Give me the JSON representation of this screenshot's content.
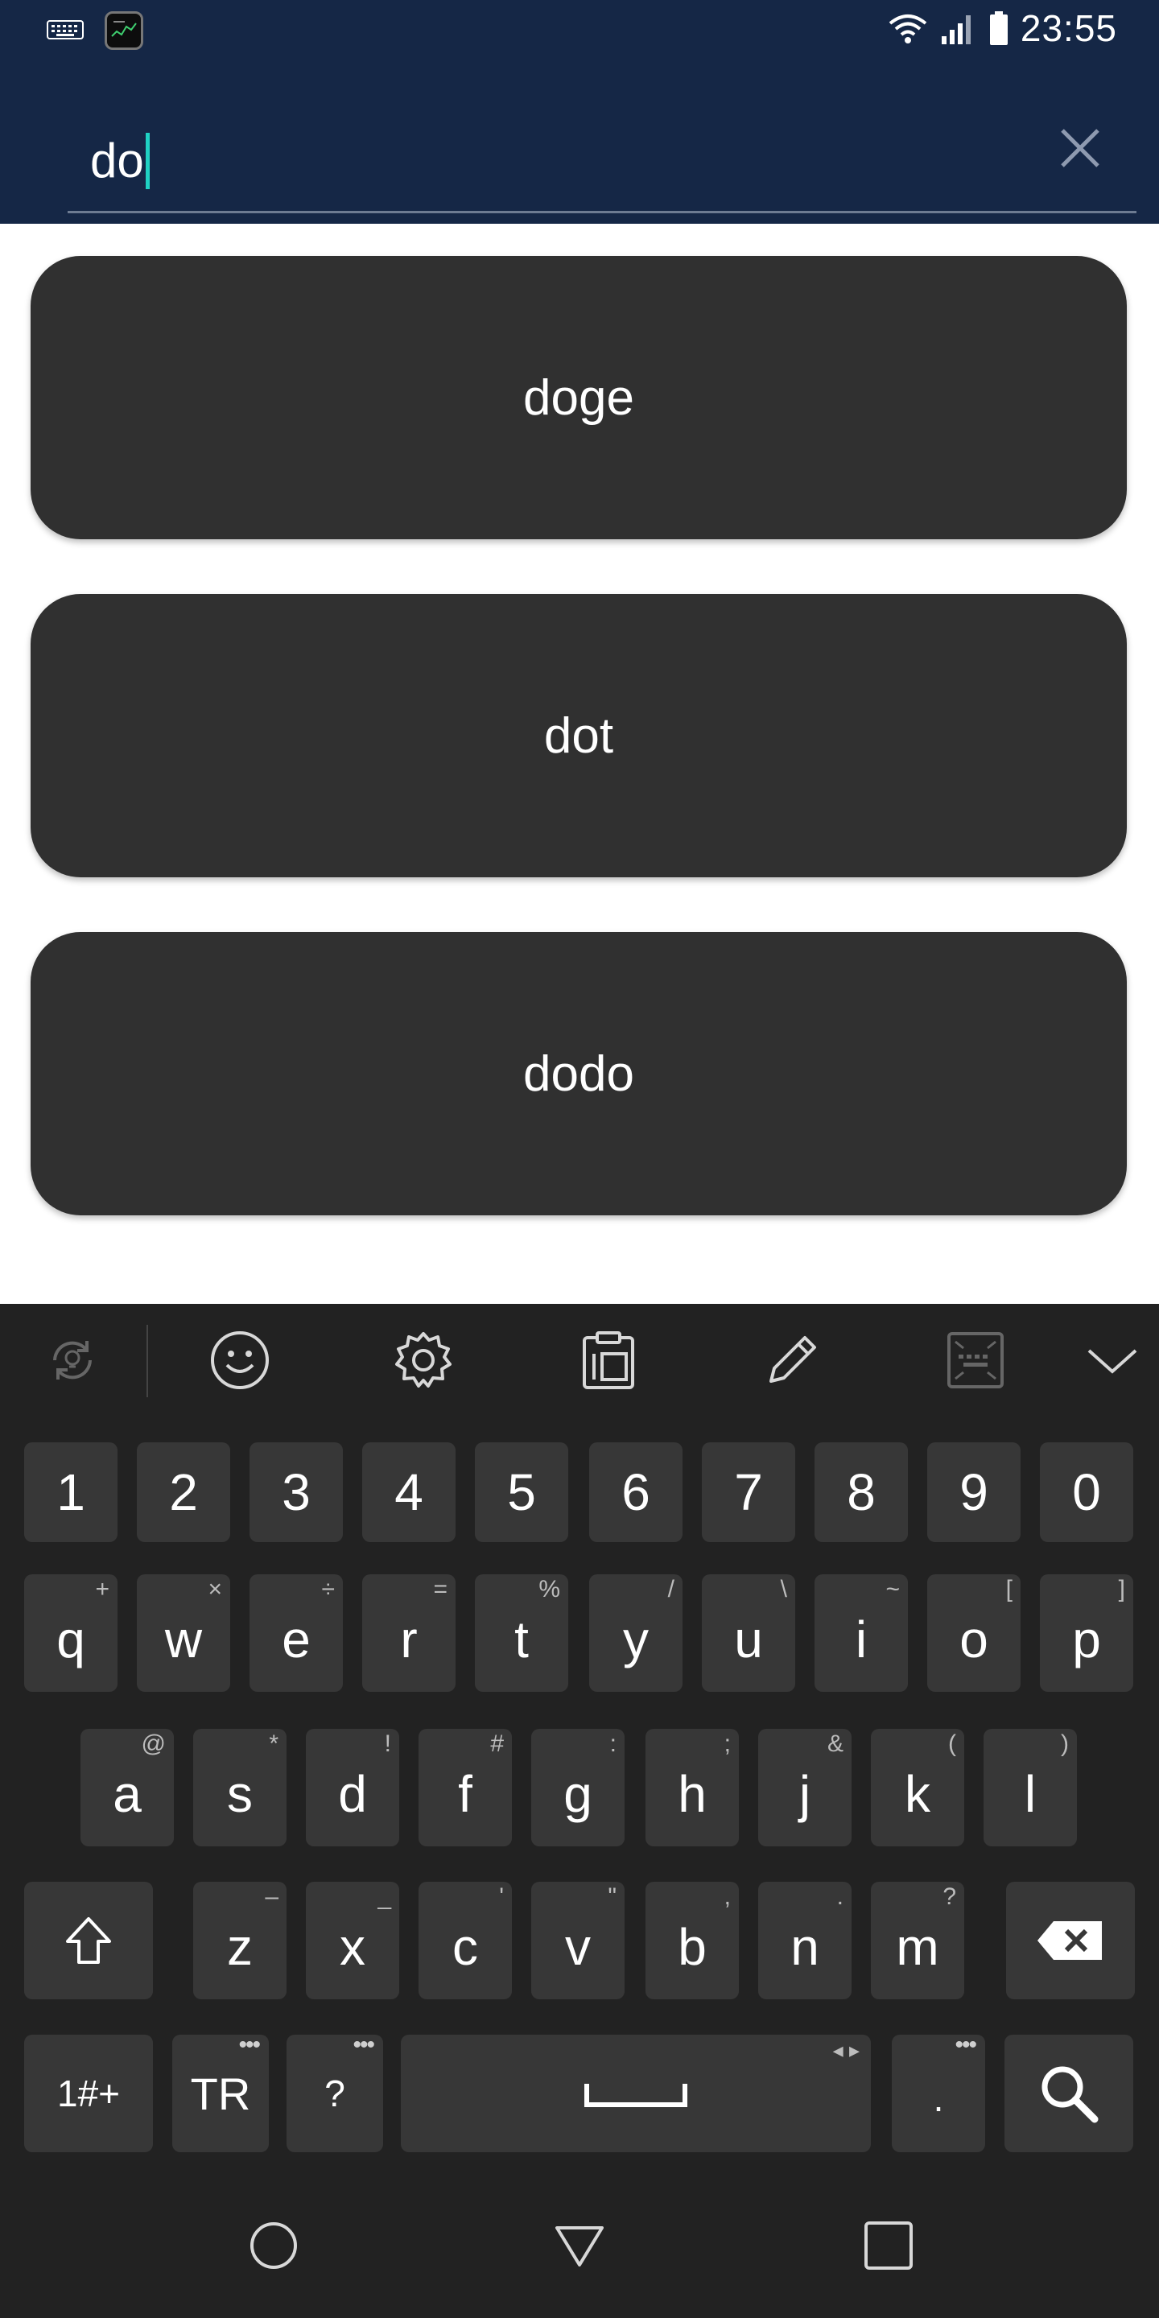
{
  "status_bar": {
    "time": "23:55",
    "icons": [
      "keyboard-icon",
      "app-notification-icon",
      "wifi-icon",
      "cellular-signal-icon",
      "battery-icon"
    ]
  },
  "search": {
    "value": "do",
    "clear_icon": "close-icon"
  },
  "results": [
    {
      "label": "doge"
    },
    {
      "label": "dot"
    },
    {
      "label": "dodo"
    }
  ],
  "keyboard": {
    "toolbar_icons": [
      "sync-icon",
      "emoji-icon",
      "settings-icon",
      "clipboard-icon",
      "pen-icon",
      "resize-icon",
      "chevron-down-icon"
    ],
    "number_row": [
      "1",
      "2",
      "3",
      "4",
      "5",
      "6",
      "7",
      "8",
      "9",
      "0"
    ],
    "row1": [
      {
        "key": "q",
        "hint": "+"
      },
      {
        "key": "w",
        "hint": "×"
      },
      {
        "key": "e",
        "hint": "÷"
      },
      {
        "key": "r",
        "hint": "="
      },
      {
        "key": "t",
        "hint": "%"
      },
      {
        "key": "y",
        "hint": "/"
      },
      {
        "key": "u",
        "hint": "\\"
      },
      {
        "key": "i",
        "hint": "~"
      },
      {
        "key": "o",
        "hint": "["
      },
      {
        "key": "p",
        "hint": "]"
      }
    ],
    "row2": [
      {
        "key": "a",
        "hint": "@"
      },
      {
        "key": "s",
        "hint": "*"
      },
      {
        "key": "d",
        "hint": "!"
      },
      {
        "key": "f",
        "hint": "#"
      },
      {
        "key": "g",
        "hint": ":"
      },
      {
        "key": "h",
        "hint": ";"
      },
      {
        "key": "j",
        "hint": "&"
      },
      {
        "key": "k",
        "hint": "("
      },
      {
        "key": "l",
        "hint": ")"
      }
    ],
    "row3": [
      {
        "key": "z",
        "hint": "–"
      },
      {
        "key": "x",
        "hint": "_"
      },
      {
        "key": "c",
        "hint": "'"
      },
      {
        "key": "v",
        "hint": "\""
      },
      {
        "key": "b",
        "hint": ","
      },
      {
        "key": "n",
        "hint": "."
      },
      {
        "key": "m",
        "hint": "?"
      }
    ],
    "symbols_label": "1#+",
    "language_label": "TR",
    "question_label": "?",
    "period_label": ".",
    "space_arrows": "◂ ▸"
  },
  "nav_bar": {
    "icons": [
      "home-circle-icon",
      "back-triangle-icon",
      "recents-square-icon"
    ]
  }
}
